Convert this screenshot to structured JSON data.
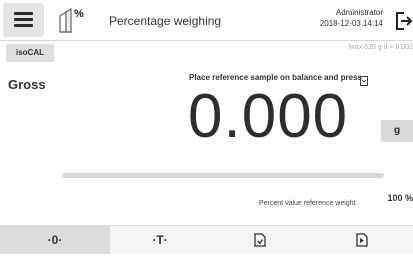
{
  "header": {
    "title": "Percentage weighing",
    "app_icon_label": "%",
    "user": "Administrator",
    "datetime": "2018-12-03  14:14"
  },
  "status": {
    "iscal_label": "isoCAL",
    "mode_label": "Gross",
    "max_info": "Max 620 g  d = 0.001"
  },
  "main": {
    "instruction": "Place reference sample on balance and press",
    "value": "0.000",
    "unit": "g",
    "percent": "100 %",
    "percent_label": "Percent value reference weight"
  },
  "bottom": {
    "zero_label": "·0·",
    "tare_label": "·T·"
  }
}
